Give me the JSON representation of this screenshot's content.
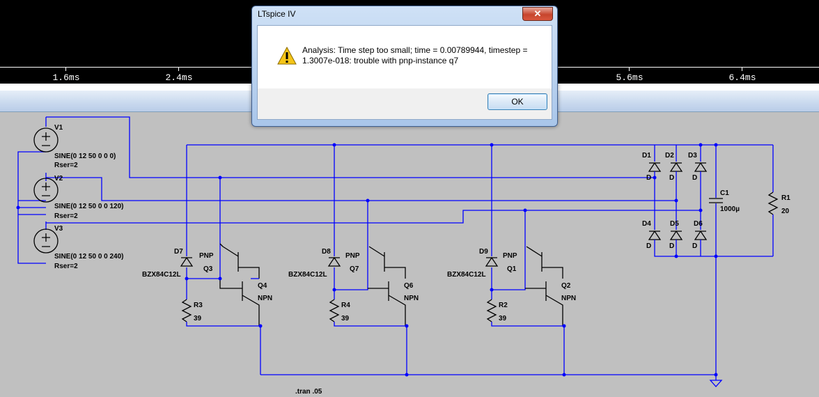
{
  "waveform": {
    "ticks": [
      "1.6ms",
      "2.4ms",
      "5.6ms",
      "6.4ms"
    ]
  },
  "dialog": {
    "title": "LTspice IV",
    "close_label": "✕",
    "message": "Analysis:  Time step too small; time = 0.00789944, timestep = 1.3007e-018: trouble with pnp-instance q7",
    "icon": "warning-icon",
    "ok_label": "OK"
  },
  "schematic": {
    "sources": [
      {
        "name": "V1",
        "value": "SINE(0 12 50 0 0 0)",
        "rser": "Rser=2"
      },
      {
        "name": "V2",
        "value": "SINE(0 12 50 0 0 120)",
        "rser": "Rser=2"
      },
      {
        "name": "V3",
        "value": "SINE(0 12 50 0 0 240)",
        "rser": "Rser=2"
      }
    ],
    "stages": [
      {
        "zener": "D7",
        "zener_model": "BZX84C12L",
        "pnp_type": "PNP",
        "pnp": "Q3",
        "npn": "Q4",
        "npn_type": "NPN",
        "res": "R3",
        "res_val": "39"
      },
      {
        "zener": "D8",
        "zener_model": "BZX84C12L",
        "pnp_type": "PNP",
        "pnp": "Q7",
        "npn": "Q6",
        "npn_type": "NPN",
        "res": "R4",
        "res_val": "39"
      },
      {
        "zener": "D9",
        "zener_model": "BZX84C12L",
        "pnp_type": "PNP",
        "pnp": "Q1",
        "npn": "Q2",
        "npn_type": "NPN",
        "res": "R2",
        "res_val": "39"
      }
    ],
    "diodes": [
      "D1",
      "D2",
      "D3",
      "D4",
      "D5",
      "D6"
    ],
    "diode_model": "D",
    "cap": {
      "name": "C1",
      "value": "1000µ"
    },
    "load": {
      "name": "R1",
      "value": "20"
    },
    "directive": ".tran .05"
  },
  "colors": {
    "wire": "#0000ff",
    "background": "#c0c0c0",
    "plot_bg": "#000000"
  }
}
